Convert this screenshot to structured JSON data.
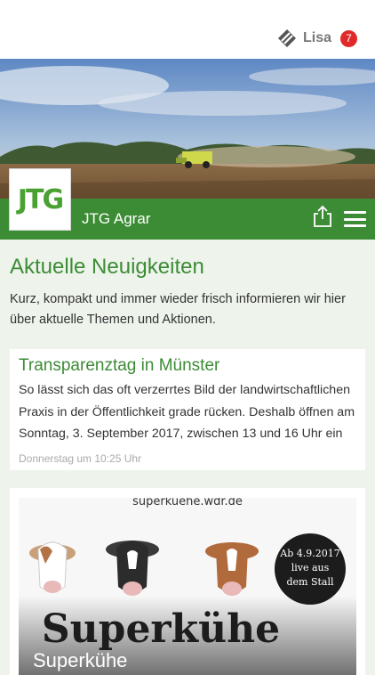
{
  "header": {
    "user_name": "Lisa",
    "badge_count": "7",
    "brand": "JTG Agrar",
    "logo_text": "JTG"
  },
  "main": {
    "section_title": "Aktuelle Neuigkeiten",
    "intro": "Kurz, kompakt und immer wieder frisch informieren wir hier über aktuelle Themen und Aktionen.",
    "posts": [
      {
        "title": "Transparenztag in Münster",
        "text": "So lässt sich das oft verzerrtes Bild der landwirtschaftlichen Praxis in der Öffentlichkeit grade rücken. Deshalb öffnen am Sonntag, 3. September 2017, zwischen 13 und 16 Uhr ein",
        "date": "Donnerstag um 10:25 Uhr"
      },
      {
        "title": "Superkühe",
        "image": {
          "url_text": "superkuehe.wdr.de",
          "headline": "Superkühe",
          "stamp_line1": "Ab 4.9.2017",
          "stamp_line2": "live aus",
          "stamp_line3": "dem Stall"
        }
      }
    ]
  },
  "colors": {
    "brand_green": "#3c8c35",
    "badge_red": "#e02a2a",
    "background": "#eef4ec"
  },
  "icons": [
    "logo-icon",
    "share-icon",
    "menu-icon"
  ]
}
